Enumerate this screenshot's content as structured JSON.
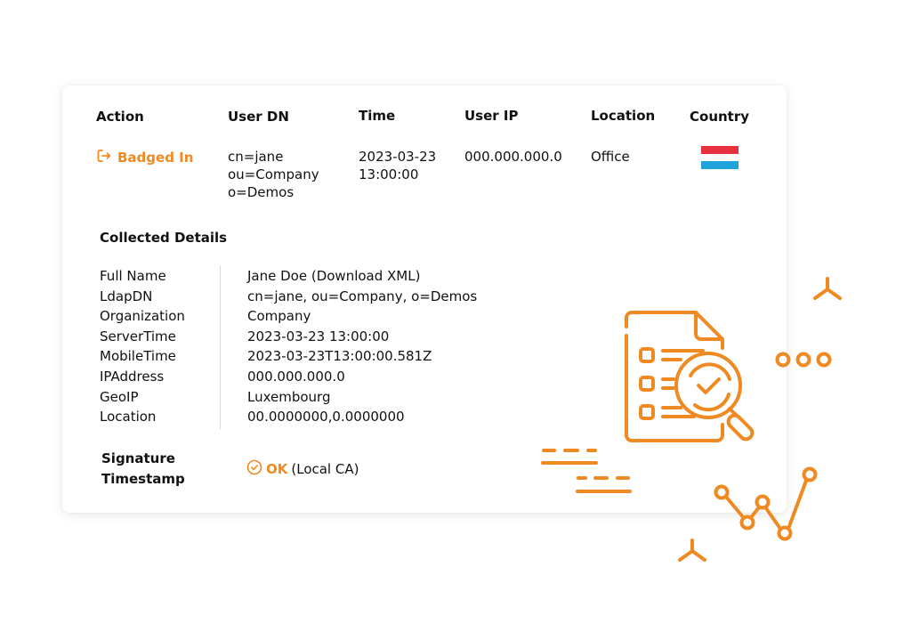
{
  "table": {
    "headers": [
      "Action",
      "User DN",
      "Time",
      "User IP",
      "Location",
      "Country"
    ],
    "row": {
      "action": {
        "label": "Badged In",
        "icon": "sign-in-icon"
      },
      "user_dn": [
        "cn=jane",
        "ou=Company",
        "o=Demos"
      ],
      "time": [
        "2023-03-23",
        "13:00:00"
      ],
      "user_ip": "000.000.000.0",
      "location": "Office",
      "country": {
        "name": "Luxembourg",
        "flag_colors": [
          "#e8313f",
          "#ffffff",
          "#1fa3dd"
        ]
      }
    }
  },
  "details": {
    "title": "Collected Details",
    "fields": [
      {
        "label": "Full Name",
        "value": "Jane Doe (Download XML)"
      },
      {
        "label": "LdapDN",
        "value": "cn=jane, ou=Company, o=Demos"
      },
      {
        "label": "Organization",
        "value": "Company"
      },
      {
        "label": "ServerTime",
        "value": "2023-03-23 13:00:00"
      },
      {
        "label": "MobileTime",
        "value": "2023-03-23T13:00:00.581Z"
      },
      {
        "label": "IPAddress",
        "value": "000.000.000.0"
      },
      {
        "label": "GeoIP",
        "value": "Luxembourg"
      },
      {
        "label": "Location",
        "value": "00.0000000,0.0000000"
      }
    ]
  },
  "signature": {
    "label_line1": "Signature",
    "label_line2": "Timestamp",
    "status": "OK",
    "detail": "(Local CA)",
    "icon": "check-circle-icon"
  },
  "colors": {
    "accent": "#ef8a23",
    "text": "#111111"
  }
}
